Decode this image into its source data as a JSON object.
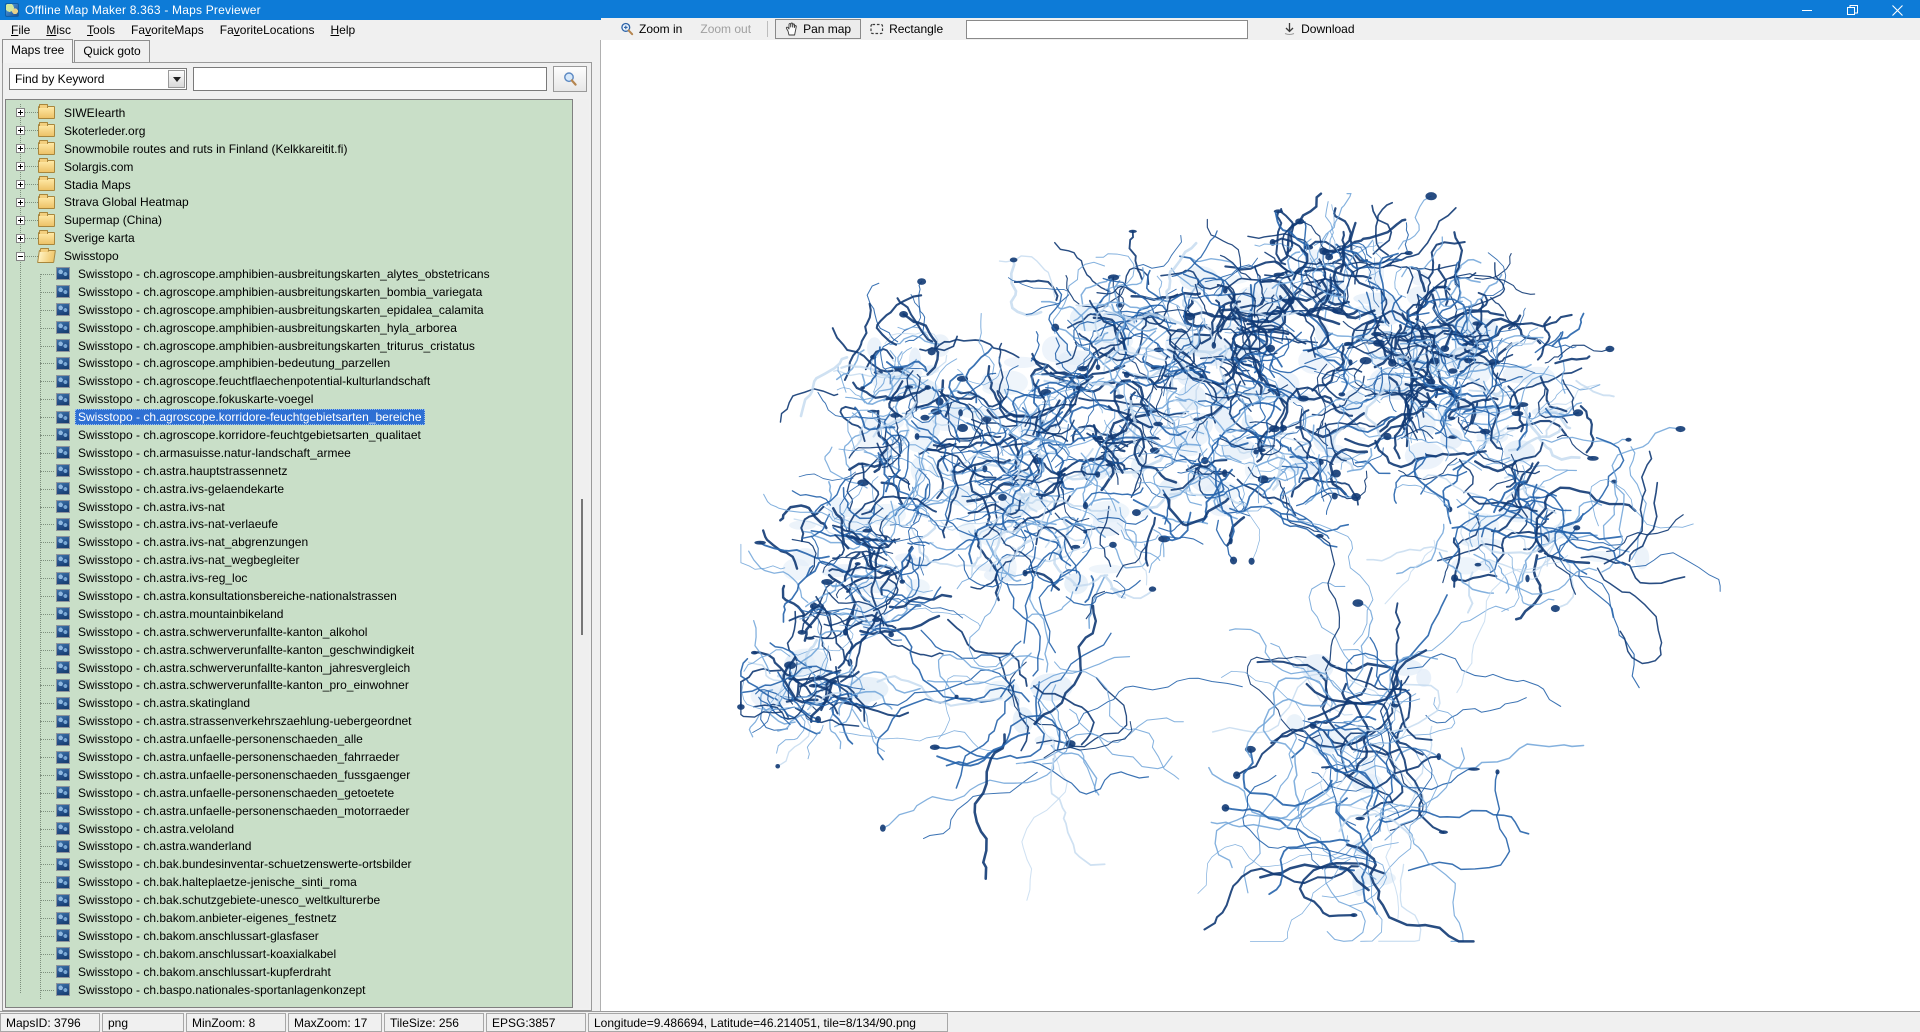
{
  "window": {
    "title": "Offline Map Maker 8.363 - Maps Previewer",
    "app_icon": "map-globe-icon",
    "controls": {
      "minimize": "minimize",
      "restore": "restore",
      "close": "close"
    }
  },
  "menu": {
    "items": [
      {
        "label": "File",
        "accel_index": 0
      },
      {
        "label": "Misc",
        "accel_index": 0
      },
      {
        "label": "Tools",
        "accel_index": 0
      },
      {
        "label": "FavoriteMaps",
        "accel_index": 2
      },
      {
        "label": "FavoriteLocations",
        "accel_index": 2
      },
      {
        "label": "Help",
        "accel_index": 0
      }
    ]
  },
  "tabs": [
    {
      "label": "Maps tree",
      "active": true
    },
    {
      "label": "Quick goto",
      "active": false
    }
  ],
  "search": {
    "mode_value": "Find by Keyword",
    "query_value": "",
    "button_icon": "magnifier-icon"
  },
  "toolbar": {
    "zoom_in_label": "Zoom in",
    "zoom_out_label": "Zoom out",
    "pan_map_label": "Pan map",
    "rectangle_label": "Rectangle",
    "coords_value": "",
    "download_label": "Download"
  },
  "tree": {
    "root_folders": [
      "SIWEIearth",
      "Skoterleder.org",
      "Snowmobile routes and ruts in Finland (Kelkkareitit.fi)",
      "Solargis.com",
      "Stadia Maps",
      "Strava Global Heatmap",
      "Supermap (China)",
      "Sverige karta"
    ],
    "expanded_folder": "Swisstopo",
    "selected_item": "Swisstopo - ch.agroscope.korridore-feuchtgebietsarten_bereiche",
    "children": [
      "Swisstopo - ch.agroscope.amphibien-ausbreitungskarten_alytes_obstetricans",
      "Swisstopo - ch.agroscope.amphibien-ausbreitungskarten_bombia_variegata",
      "Swisstopo - ch.agroscope.amphibien-ausbreitungskarten_epidalea_calamita",
      "Swisstopo - ch.agroscope.amphibien-ausbreitungskarten_hyla_arborea",
      "Swisstopo - ch.agroscope.amphibien-ausbreitungskarten_triturus_cristatus",
      "Swisstopo - ch.agroscope.amphibien-bedeutung_parzellen",
      "Swisstopo - ch.agroscope.feuchtflaechenpotential-kulturlandschaft",
      "Swisstopo - ch.agroscope.fokuskarte-voegel",
      "Swisstopo - ch.agroscope.korridore-feuchtgebietsarten_bereiche",
      "Swisstopo - ch.agroscope.korridore-feuchtgebietsarten_qualitaet",
      "Swisstopo - ch.armasuisse.natur-landschaft_armee",
      "Swisstopo - ch.astra.hauptstrassennetz",
      "Swisstopo - ch.astra.ivs-gelaendekarte",
      "Swisstopo - ch.astra.ivs-nat",
      "Swisstopo - ch.astra.ivs-nat-verlaeufe",
      "Swisstopo - ch.astra.ivs-nat_abgrenzungen",
      "Swisstopo - ch.astra.ivs-nat_wegbegleiter",
      "Swisstopo - ch.astra.ivs-reg_loc",
      "Swisstopo - ch.astra.konsultationsbereiche-nationalstrassen",
      "Swisstopo - ch.astra.mountainbikeland",
      "Swisstopo - ch.astra.schwerverunfallte-kanton_alkohol",
      "Swisstopo - ch.astra.schwerverunfallte-kanton_geschwindigkeit",
      "Swisstopo - ch.astra.schwerverunfallte-kanton_jahresvergleich",
      "Swisstopo - ch.astra.schwerverunfallte-kanton_pro_einwohner",
      "Swisstopo - ch.astra.skatingland",
      "Swisstopo - ch.astra.strassenverkehrszaehlung-uebergeordnet",
      "Swisstopo - ch.astra.unfaelle-personenschaeden_alle",
      "Swisstopo - ch.astra.unfaelle-personenschaeden_fahrraeder",
      "Swisstopo - ch.astra.unfaelle-personenschaeden_fussgaenger",
      "Swisstopo - ch.astra.unfaelle-personenschaeden_getoetete",
      "Swisstopo - ch.astra.unfaelle-personenschaeden_motorraeder",
      "Swisstopo - ch.astra.veloland",
      "Swisstopo - ch.astra.wanderland",
      "Swisstopo - ch.bak.bundesinventar-schuetzenswerte-ortsbilder",
      "Swisstopo - ch.bak.halteplaetze-jenische_sinti_roma",
      "Swisstopo - ch.bak.schutzgebiete-unesco_weltkulturerbe",
      "Swisstopo - ch.bakom.anbieter-eigenes_festnetz",
      "Swisstopo - ch.bakom.anschlussart-glasfaser",
      "Swisstopo - ch.bakom.anschlussart-koaxialkabel",
      "Swisstopo - ch.bakom.anschlussart-kupferdraht",
      "Swisstopo - ch.baspo.nationales-sportanlagenkonzept"
    ]
  },
  "map_preview": {
    "description": "Preview of Swisstopo layer tiles: dense blue corridor/wetland network in the shape of Switzerland on a white background",
    "palette": {
      "dark_blue": "#113a74",
      "mid_blue": "#2563ab",
      "light_blue": "#6fa3d8",
      "pale_blue": "#c3d9ef",
      "haze_blue": "#e2edf8"
    }
  },
  "status": {
    "items": [
      "MapsID: 3796",
      "png",
      "MinZoom: 8",
      "MaxZoom: 17",
      "TileSize: 256",
      "EPSG:3857",
      "Longitude=9.486694, Latitude=46.214051, tile=8/134/90.png"
    ]
  }
}
